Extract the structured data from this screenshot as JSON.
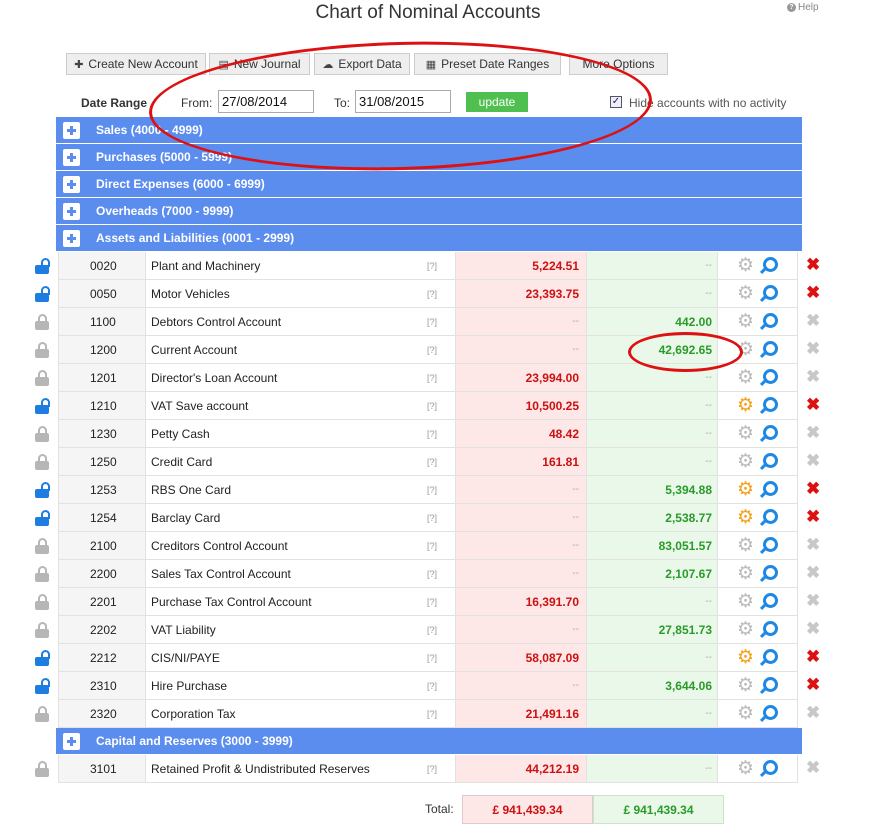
{
  "page": {
    "title": "Chart of Nominal Accounts",
    "help": "Help"
  },
  "toolbar": {
    "create_new_account": "Create New Account",
    "new_journal": "New Journal",
    "export_data": "Export Data",
    "preset_date_ranges": "Preset Date Ranges",
    "more_options": "More Options"
  },
  "filters": {
    "date_range_label": "Date Range",
    "from_label": "From:",
    "from_value": "27/08/2014",
    "to_label": "To:",
    "to_value": "31/08/2015",
    "update": "update",
    "hide_inactive_label": "Hide accounts with no activity",
    "hide_inactive_checked": true
  },
  "groups": {
    "sales": "Sales (4000 - 4999)",
    "purchases": "Purchases (5000 - 5999)",
    "direct_expenses": "Direct Expenses (6000 - 6999)",
    "overheads": "Overheads (7000 - 9999)",
    "assets_liabilities": "Assets and Liabilities (0001 - 2999)",
    "capital_reserves": "Capital and Reserves (3000 - 3999)"
  },
  "placeholder_dash": "--",
  "help_marker": "[?]",
  "accounts": [
    {
      "code": "0020",
      "name": "Plant and Machinery",
      "debit": "5,224.51",
      "credit": "--",
      "locked": false,
      "gear": "grey",
      "deletable": true
    },
    {
      "code": "0050",
      "name": "Motor Vehicles",
      "debit": "23,393.75",
      "credit": "--",
      "locked": false,
      "gear": "grey",
      "deletable": true
    },
    {
      "code": "1100",
      "name": "Debtors Control Account",
      "debit": "--",
      "credit": "442.00",
      "locked": true,
      "gear": "grey",
      "deletable": false
    },
    {
      "code": "1200",
      "name": "Current Account",
      "debit": "--",
      "credit": "42,692.65",
      "locked": true,
      "gear": "grey",
      "deletable": false
    },
    {
      "code": "1201",
      "name": "Director's Loan Account",
      "debit": "23,994.00",
      "credit": "--",
      "locked": true,
      "gear": "grey",
      "deletable": false
    },
    {
      "code": "1210",
      "name": "VAT Save account",
      "debit": "10,500.25",
      "credit": "--",
      "locked": false,
      "gear": "orange",
      "deletable": true
    },
    {
      "code": "1230",
      "name": "Petty Cash",
      "debit": "48.42",
      "credit": "--",
      "locked": true,
      "gear": "grey",
      "deletable": false
    },
    {
      "code": "1250",
      "name": "Credit Card",
      "debit": "161.81",
      "credit": "--",
      "locked": true,
      "gear": "grey",
      "deletable": false
    },
    {
      "code": "1253",
      "name": "RBS One Card",
      "debit": "--",
      "credit": "5,394.88",
      "locked": false,
      "gear": "orange",
      "deletable": true
    },
    {
      "code": "1254",
      "name": "Barclay Card",
      "debit": "--",
      "credit": "2,538.77",
      "locked": false,
      "gear": "orange",
      "deletable": true
    },
    {
      "code": "2100",
      "name": "Creditors Control Account",
      "debit": "--",
      "credit": "83,051.57",
      "locked": true,
      "gear": "grey",
      "deletable": false
    },
    {
      "code": "2200",
      "name": "Sales Tax Control Account",
      "debit": "--",
      "credit": "2,107.67",
      "locked": true,
      "gear": "grey",
      "deletable": false
    },
    {
      "code": "2201",
      "name": "Purchase Tax Control Account",
      "debit": "16,391.70",
      "credit": "--",
      "locked": true,
      "gear": "grey",
      "deletable": false
    },
    {
      "code": "2202",
      "name": "VAT Liability",
      "debit": "--",
      "credit": "27,851.73",
      "locked": true,
      "gear": "grey",
      "deletable": false
    },
    {
      "code": "2212",
      "name": "CIS/NI/PAYE",
      "debit": "58,087.09",
      "credit": "--",
      "locked": false,
      "gear": "orange",
      "deletable": true
    },
    {
      "code": "2310",
      "name": "Hire Purchase",
      "debit": "--",
      "credit": "3,644.06",
      "locked": false,
      "gear": "grey",
      "deletable": true
    },
    {
      "code": "2320",
      "name": "Corporation Tax",
      "debit": "21,491.16",
      "credit": "--",
      "locked": true,
      "gear": "grey",
      "deletable": false
    }
  ],
  "capital_accounts": [
    {
      "code": "3101",
      "name": "Retained Profit & Undistributed Reserves",
      "debit": "44,212.19",
      "credit": "--",
      "locked": true,
      "gear": "grey",
      "deletable": false
    }
  ],
  "totals": {
    "label": "Total:",
    "debit": "£ 941,439.34",
    "credit": "£ 941,439.34"
  },
  "colors": {
    "group_header": "#5b8def",
    "debit_text": "#cc1111",
    "credit_text": "#2a9a2a",
    "annotation": "#dd1111",
    "update_button": "#4fbf4f"
  }
}
